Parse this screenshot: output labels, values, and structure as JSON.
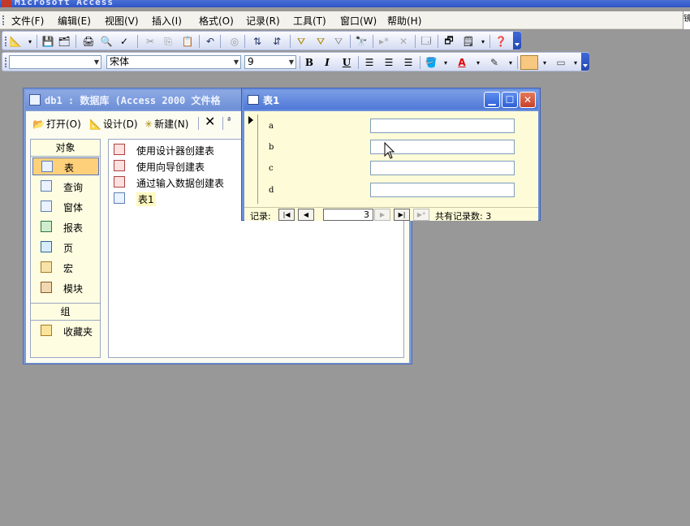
{
  "app": {
    "title": "Microsoft Access",
    "right_edge_char": "镜"
  },
  "menu": [
    "文件(F)",
    "编辑(E)",
    "视图(V)",
    "插入(I)",
    "格式(O)",
    "记录(R)",
    "工具(T)",
    "窗口(W)",
    "帮助(H)"
  ],
  "format_toolbar": {
    "font_name": "宋体",
    "font_size": "9",
    "bold": "B",
    "italic": "I",
    "underline": "U"
  },
  "db_window": {
    "title": "db1 : 数据库 (Access 2000 文件格",
    "toolbar": {
      "open": "打开(O)",
      "design": "设计(D)",
      "new": "新建(N)"
    },
    "objects_header": "对象",
    "objects": [
      "表",
      "查询",
      "窗体",
      "报表",
      "页",
      "宏",
      "模块"
    ],
    "groups_header": "组",
    "groups": [
      "收藏夹"
    ],
    "list": [
      "使用设计器创建表",
      "使用向导创建表",
      "通过输入数据创建表",
      "表1"
    ]
  },
  "form_window": {
    "title": "表1",
    "fields": [
      {
        "label": "a",
        "value": ""
      },
      {
        "label": "b",
        "value": ""
      },
      {
        "label": "c",
        "value": ""
      },
      {
        "label": "d",
        "value": ""
      }
    ],
    "nav": {
      "label": "记录:",
      "current": "3",
      "total_text": "共有记录数: 3"
    }
  }
}
